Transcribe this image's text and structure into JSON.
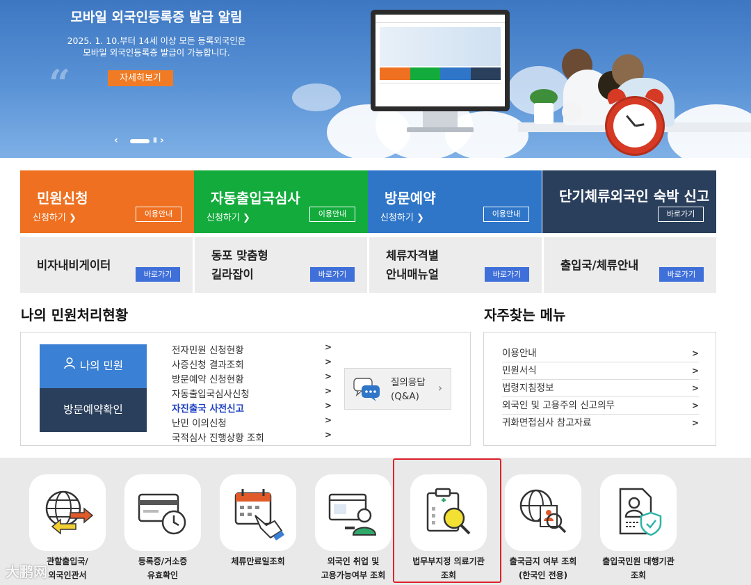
{
  "banner": {
    "title": "모바일 외국인등록증 발급 알림",
    "desc_line1": "2025. 1. 10.부터 14세 이상 모든 등록외국인은",
    "desc_line2": "모바일 외국인등록증 발급이 가능합니다.",
    "button_label": "자세히보기"
  },
  "tiles": [
    {
      "title": "민원신청",
      "sub": "신청하기",
      "button": "이용안내",
      "color": "#ee7020"
    },
    {
      "title": "자동출입국심사",
      "sub": "신청하기",
      "button": "이용안내",
      "color": "#13ab3c"
    },
    {
      "title": "방문예약",
      "sub": "신청하기",
      "button": "이용안내",
      "color": "#2f76c9"
    },
    {
      "title": "단기체류외국인 숙박 신고",
      "sub": "",
      "button": "바로가기",
      "color": "#2a3f5c"
    }
  ],
  "sub_tiles": [
    {
      "line1": "비자내비게이터",
      "line2": "",
      "button": "바로가기"
    },
    {
      "line1": "동포 맞춤형",
      "line2": "길라잡이",
      "button": "바로가기"
    },
    {
      "line1": "체류자격별",
      "line2": "안내매뉴얼",
      "button": "바로가기"
    },
    {
      "line1": "출입국/체류안내",
      "line2": "",
      "button": "바로가기"
    }
  ],
  "my_status": {
    "title": "나의 민원처리현황",
    "my_button": "나의 민원",
    "visit_button": "방문예약확인",
    "items": [
      "전자민원 신청현황",
      "사증신청 결과조회",
      "방문예약 신청현황",
      "자동출입국심사신청",
      "자진출국 사전신고",
      "난민 이의신청",
      "국적심사 진행상황 조회"
    ],
    "qna_line1": "질의응답",
    "qna_line2": "(Q&A)"
  },
  "favorites": {
    "title": "자주찾는 메뉴",
    "items": [
      "이용안내",
      "민원서식",
      "법령지침정보",
      "외국인 및 고용주의 신고의무",
      "귀화면접심사 참고자료"
    ]
  },
  "quick": [
    {
      "line1": "관할출입국/",
      "line2": "외국인관서",
      "icon": "globe-arrows-icon"
    },
    {
      "line1": "등록증/거소증",
      "line2": "유효확인",
      "icon": "card-clock-icon"
    },
    {
      "line1": "체류만료일조회",
      "line2": "",
      "icon": "calendar-hand-icon"
    },
    {
      "line1": "외국인 취업 및",
      "line2": "고용가능여부 조회",
      "icon": "monitor-worker-icon"
    },
    {
      "line1": "법무부지정 의료기관",
      "line2": "조회",
      "icon": "clipboard-magnifier-icon"
    },
    {
      "line1": "출국금지 여부 조회",
      "line2": "(한국인 전용)",
      "icon": "globe-person-search-icon"
    },
    {
      "line1": "출입국민원 대행기관",
      "line2": "조회",
      "icon": "document-shield-icon"
    }
  ],
  "watermark": "大鹏网",
  "arrow_glyph": ">"
}
